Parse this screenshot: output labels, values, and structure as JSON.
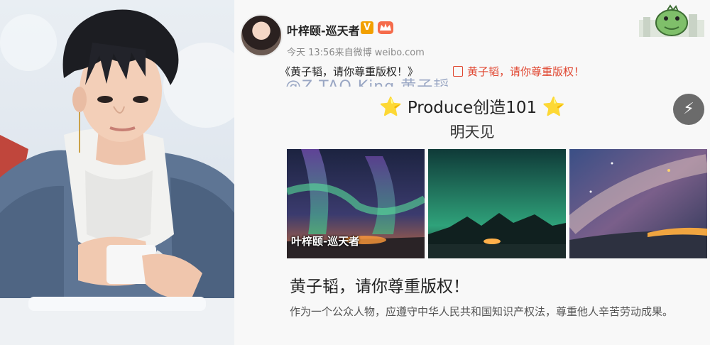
{
  "weibo": {
    "user_name": "叶梓颐-巡天者",
    "verified_badge": "V",
    "post_meta": "今天 13:56来自微博 weibo.com",
    "repost_text": "《黄子韬，请你尊重版权！》",
    "repost_link_text": "黄子韬，请你尊重版权！",
    "cut_off_line": "@Z.TAO King 黄子韬...",
    "headline": "Produce创造101",
    "headline_star": "⭐",
    "subline": "明天见",
    "thumb_watermark": "叶梓颐-巡天者",
    "article_title": "黄子韬，请你尊重版权！",
    "article_body": "作为一个公众人物，应遵守中华人民共和国知识产权法，尊重他人辛苦劳动成果。",
    "flash_icon": "⚡"
  },
  "icons": {
    "avatar": "avatar",
    "sticker": "dinosaur-sticker-icon",
    "flash": "lightning-icon",
    "link": "link-icon"
  },
  "colors": {
    "link_red": "#e0452f",
    "verified_orange": "#f2a000"
  }
}
